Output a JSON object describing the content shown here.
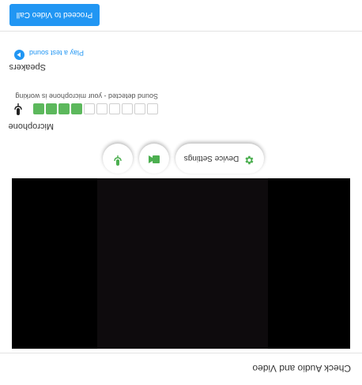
{
  "header": {
    "title": "Check Audio and Video"
  },
  "controls": {
    "device_settings_label": "Device Settings",
    "icon_color": "#4caf50"
  },
  "microphone": {
    "label": "Microphone",
    "level_bars_total": 10,
    "level_bars_active": 4,
    "active_color": "#5cb85c",
    "status_text": "Sound detected - your microphone is working"
  },
  "speakers": {
    "label": "Speakers",
    "test_link": "Play a test sound",
    "accent": "#2196f3"
  },
  "footer": {
    "proceed_label": "Proceed to Video Call",
    "accent": "#2196f3"
  }
}
